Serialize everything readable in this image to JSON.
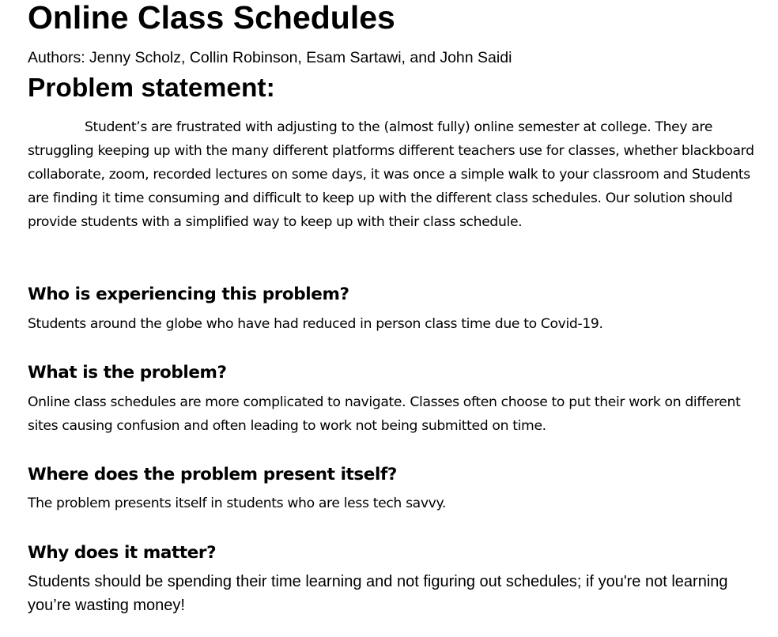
{
  "document": {
    "title": "Online Class Schedules",
    "authors": "Authors: Jenny Scholz, Collin Robinson, Esam Sartawi, and John Saidi",
    "problem_statement_heading": "Problem statement:",
    "problem_statement": "Student’s are frustrated with adjusting to the (almost fully) online semester at college. They are struggling keeping up with the many different platforms different teachers use for classes, whether blackboard collaborate, zoom, recorded lectures on some days, it was once a simple walk to your classroom and Students are finding it time consuming and difficult to keep up with the different class schedules. Our solution should provide students with a simplified way to keep up with their class schedule.",
    "sections": [
      {
        "heading": "Who is experiencing this problem?",
        "answer": "Students around the globe who have had reduced in person class time due to Covid-19."
      },
      {
        "heading": "What is the problem?",
        "answer": " Online class schedules are more complicated to navigate. Classes often choose to put their work on different sites causing confusion and often leading to work not being submitted on time."
      },
      {
        "heading": "Where does the problem present itself?",
        "answer": " The problem presents itself in students who are less tech savvy."
      },
      {
        "heading": "Why does it matter?",
        "answer": "Students should be spending their time learning and not figuring out schedules; if you're not learning you’re wasting money!"
      }
    ]
  }
}
